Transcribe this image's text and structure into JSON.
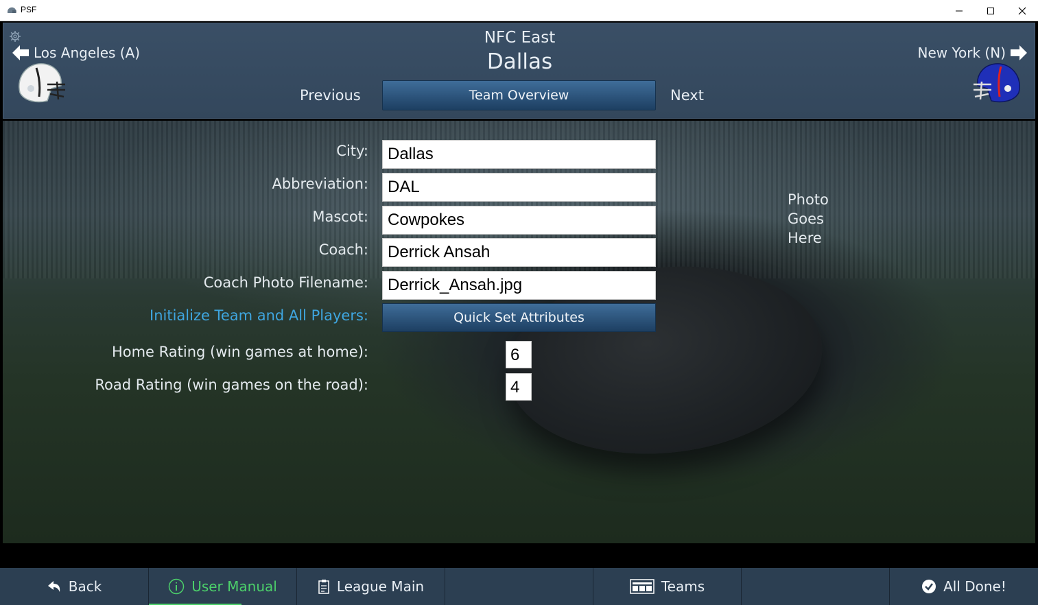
{
  "window": {
    "title": "PSF"
  },
  "header": {
    "division": "NFC East",
    "team_name": "Dallas",
    "prev_team": "Los Angeles (A)",
    "next_team": "New York (N)",
    "previous_label": "Previous",
    "next_label": "Next",
    "tab_label": "Team Overview"
  },
  "form": {
    "city_label": "City:",
    "city_value": "Dallas",
    "abbr_label": "Abbreviation:",
    "abbr_value": "DAL",
    "mascot_label": "Mascot:",
    "mascot_value": "Cowpokes",
    "coach_label": "Coach:",
    "coach_value": "Derrick Ansah",
    "photo_label": "Coach Photo Filename:",
    "photo_value": "Derrick_Ansah.jpg",
    "init_label": "Initialize Team and All Players:",
    "quick_set_label": "Quick Set Attributes",
    "home_label": "Home Rating (win games at home):",
    "home_value": "6",
    "road_label": "Road Rating (win games on the road):",
    "road_value": "4",
    "photo_placeholder": [
      "Photo",
      "Goes",
      "Here"
    ]
  },
  "bottom_nav": [
    {
      "label": "Back",
      "icon": "back-arrow-icon"
    },
    {
      "label": "User Manual",
      "icon": "info-icon",
      "active": true
    },
    {
      "label": "League Main",
      "icon": "clipboard-icon"
    },
    {
      "label": "",
      "icon": ""
    },
    {
      "label": "Teams",
      "icon": "teams-icon"
    },
    {
      "label": "",
      "icon": ""
    },
    {
      "label": "All Done!",
      "icon": "check-icon"
    }
  ],
  "colors": {
    "header_bg": "#3a4f66",
    "button_blue": "#2b5580",
    "link_blue": "#3fa6e0",
    "active_green": "#4cd06a",
    "nav_bg": "#2c3f52"
  }
}
